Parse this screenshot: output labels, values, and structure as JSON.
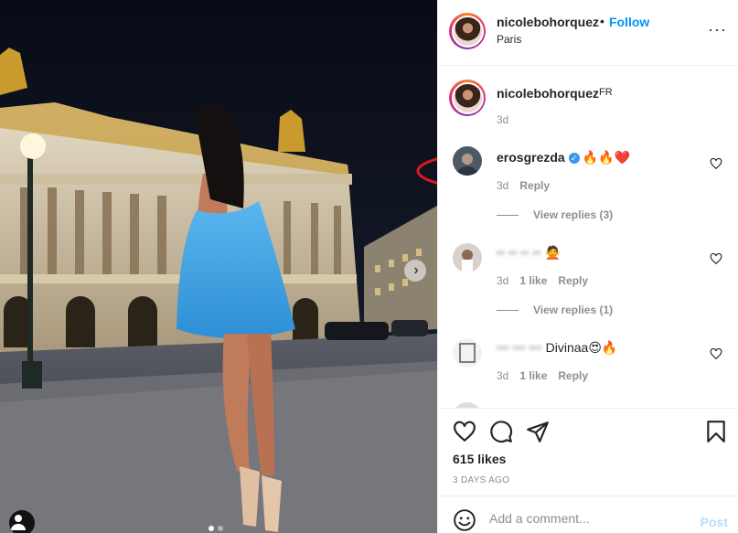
{
  "post": {
    "username": "nicolebohorquez",
    "separator": "•",
    "follow_label": "Follow",
    "location": "Paris",
    "more_label": "···"
  },
  "caption": {
    "username": "nicolebohorquez",
    "flag_text": "FR",
    "time": "3d"
  },
  "comments": [
    {
      "username": "erosgrezda",
      "verified": true,
      "text": "🔥🔥❤️",
      "time": "3d",
      "likes": "",
      "reply_label": "Reply",
      "view_replies": "View replies (3)"
    },
    {
      "username": "",
      "text": "🙅",
      "time": "3d",
      "likes": "1 like",
      "reply_label": "Reply",
      "view_replies": "View replies (1)"
    },
    {
      "username": "",
      "text": "Divinaa😍🔥",
      "time": "3d",
      "likes": "1 like",
      "reply_label": "Reply",
      "view_replies": ""
    }
  ],
  "actions": {
    "likes": "615 likes",
    "date": "3 DAYS AGO"
  },
  "add_comment": {
    "placeholder": "Add a comment...",
    "post_label": "Post"
  },
  "carousel": {
    "next_label": "›",
    "count": 2,
    "active": 0
  },
  "colors": {
    "accent": "#0095f6",
    "post_disabled": "#b2dffc",
    "annotation": "#e0161e",
    "muted": "#8e8e8e"
  },
  "icons": {
    "heart": "heart-icon",
    "comment": "comment-icon",
    "share": "share-icon",
    "save": "bookmark-icon",
    "emoji": "emoji-icon",
    "user_tag": "user-tag-icon"
  }
}
